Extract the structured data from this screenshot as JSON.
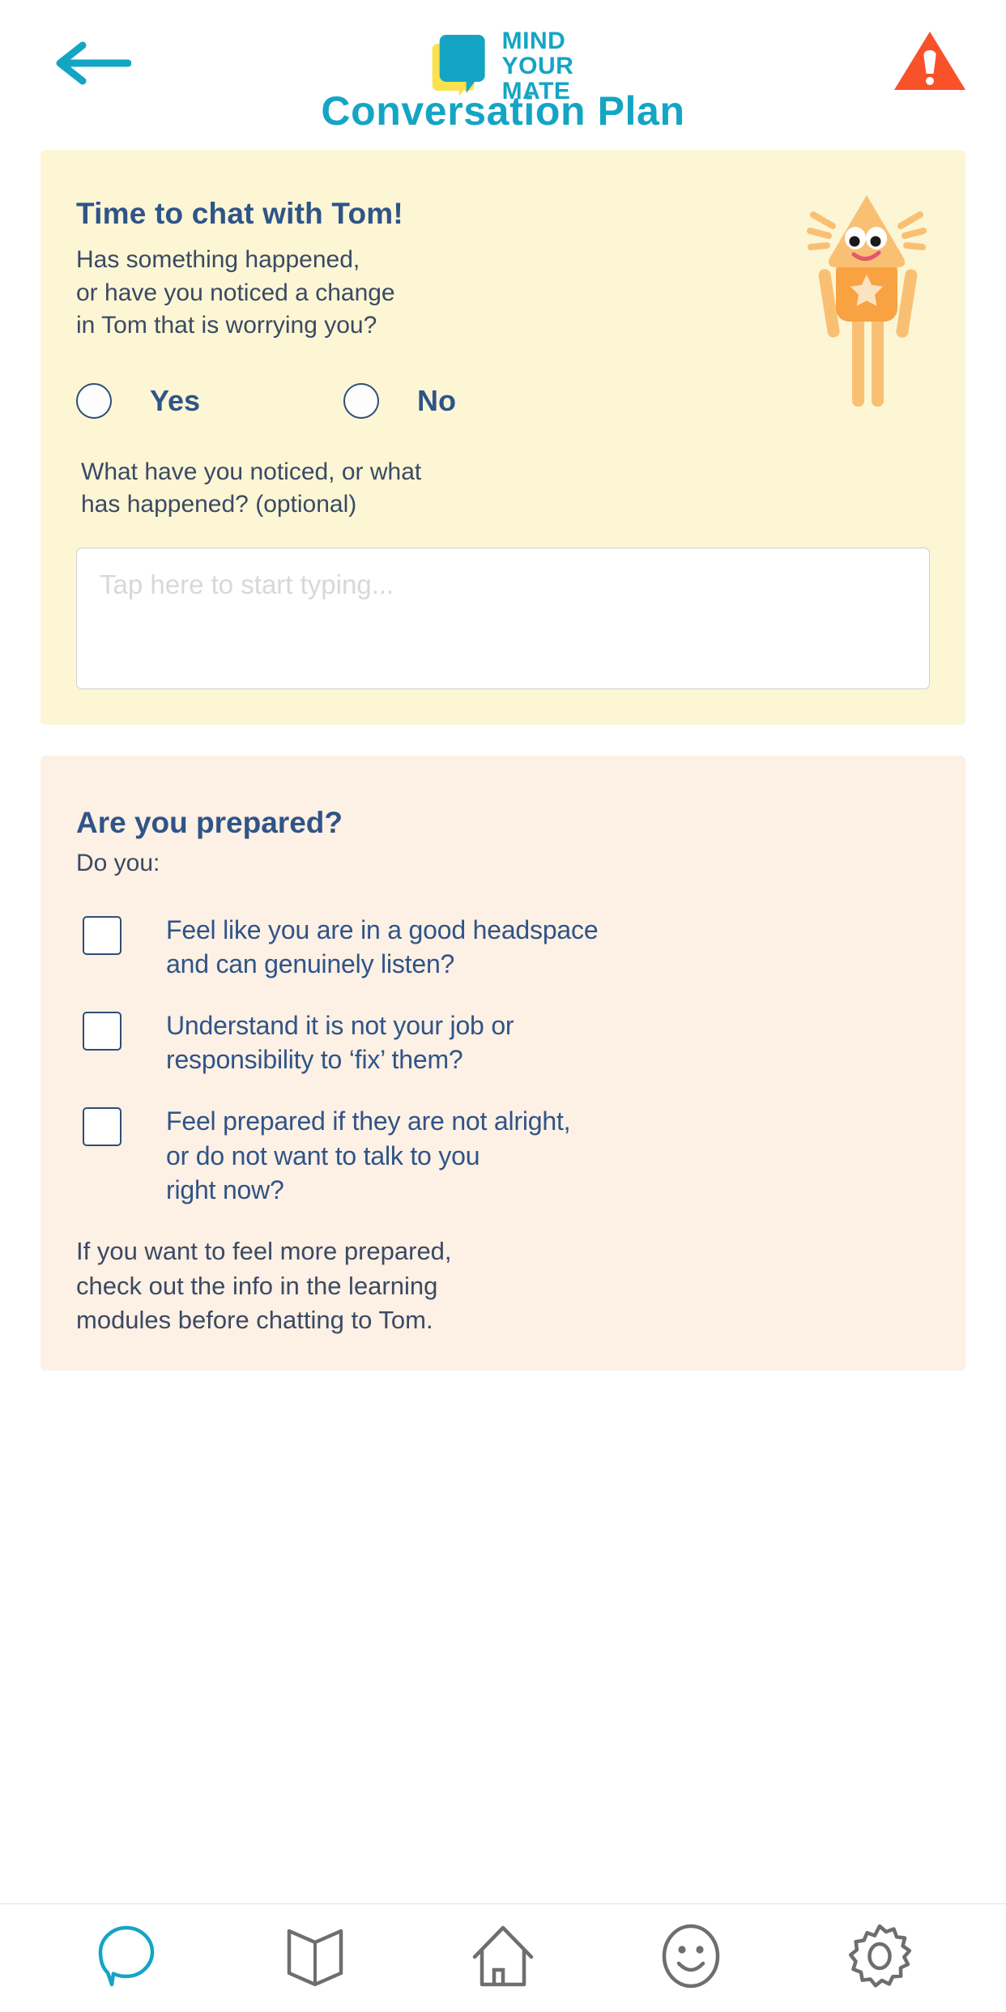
{
  "header": {
    "back_icon": "back-arrow-icon",
    "alert_icon": "alert-triangle-icon",
    "logo": {
      "line1": "MIND",
      "line2": "YOUR",
      "line3": "MATE"
    },
    "title": "Conversation Plan"
  },
  "chat_card": {
    "title": "Time to chat with Tom!",
    "subtitle": "Has something happened,\nor have you noticed a change\nin Tom that is worrying you?",
    "options": [
      {
        "label": "Yes",
        "selected": false
      },
      {
        "label": "No",
        "selected": false
      }
    ],
    "optional_question": "What have you noticed, or what\nhas happened? (optional)",
    "textarea_placeholder": "Tap here to start typing...",
    "textarea_value": "",
    "character_icon": "mascot-character-icon"
  },
  "prepared_card": {
    "title": "Are you prepared?",
    "subtitle": "Do you:",
    "checklist": [
      {
        "label": "Feel like you are in a good headspace\nand can genuinely listen?",
        "checked": false
      },
      {
        "label": "Understand it is not your job or\nresponsibility to ‘fix’ them?",
        "checked": false
      },
      {
        "label": "Feel prepared if they are not alright,\nor do not want to talk to you\nright now?",
        "checked": false
      }
    ],
    "footer": "If you want to feel more prepared,\ncheck out the info in the learning\nmodules before chatting to Tom."
  },
  "bottom_nav": [
    {
      "icon": "speech-bubble-icon",
      "active": true
    },
    {
      "icon": "open-book-icon",
      "active": false
    },
    {
      "icon": "home-icon",
      "active": false
    },
    {
      "icon": "smiley-face-icon",
      "active": false
    },
    {
      "icon": "gear-icon",
      "active": false
    }
  ],
  "colors": {
    "brand_teal": "#14A5C4",
    "brand_yellow": "#FBE14D",
    "navy_text": "#2F5488",
    "body_text": "#3A4A63",
    "card_yellow_bg": "#FCF6D5",
    "card_peach_bg": "#FDF0E4",
    "alert_orange": "#F9512A",
    "nav_inactive": "#6E6E6E"
  }
}
